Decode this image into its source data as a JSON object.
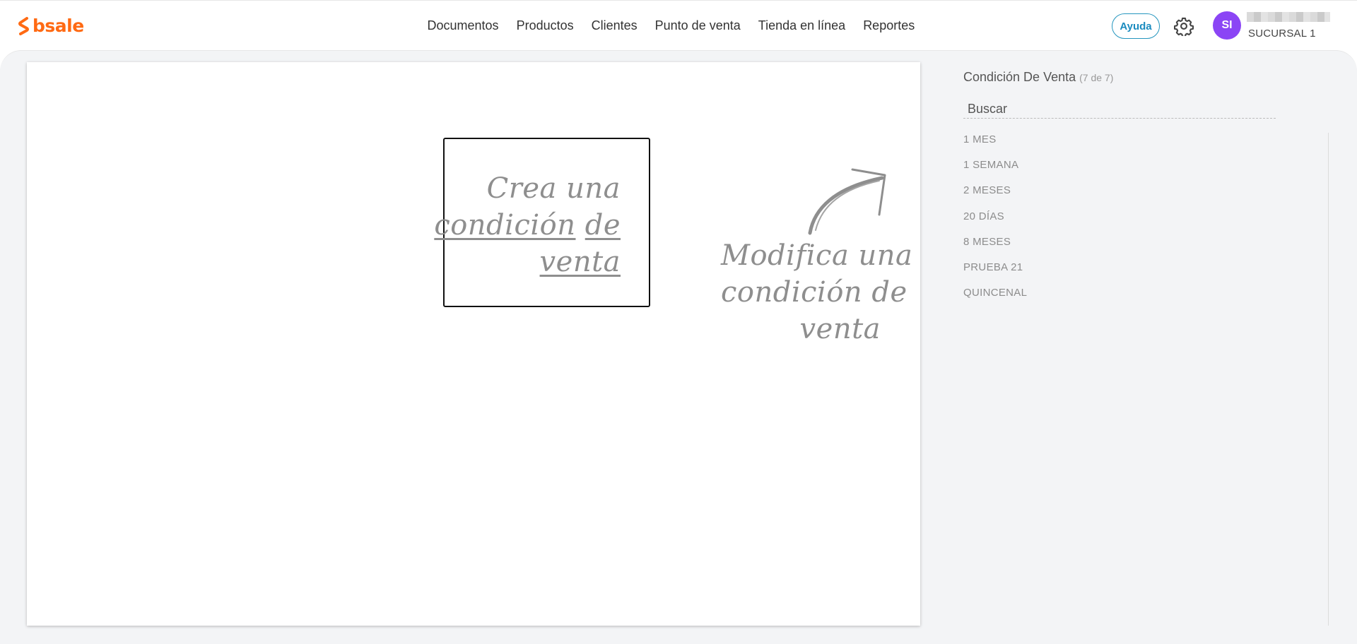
{
  "brand": {
    "name": "bsale",
    "color": "#ff6a13"
  },
  "nav": {
    "items": [
      {
        "label": "Documentos"
      },
      {
        "label": "Productos"
      },
      {
        "label": "Clientes"
      },
      {
        "label": "Punto de venta"
      },
      {
        "label": "Tienda en línea"
      },
      {
        "label": "Reportes"
      }
    ]
  },
  "header": {
    "help_label": "Ayuda",
    "settings_icon": "gear-icon",
    "avatar_initials": "SI",
    "avatar_color": "#8b45f5",
    "branch_label": "SUCURSAL 1"
  },
  "main": {
    "create": {
      "line1": "Crea una",
      "line2a": "condición",
      "line2b": "de",
      "line3": "venta"
    },
    "modify": {
      "line1": "Modifica una",
      "line2": "condición de",
      "line3": "venta"
    },
    "arrow_icon": "curved-arrow-icon"
  },
  "sidebar": {
    "title": "Condición De Venta",
    "count": "(7 de 7)",
    "search_placeholder": "Buscar",
    "items": [
      {
        "label": "1 MES"
      },
      {
        "label": "1 SEMANA"
      },
      {
        "label": "2 MESES"
      },
      {
        "label": "20 DÍAS"
      },
      {
        "label": "8 MESES"
      },
      {
        "label": "PRUEBA 21"
      },
      {
        "label": "QUINCENAL"
      }
    ]
  }
}
